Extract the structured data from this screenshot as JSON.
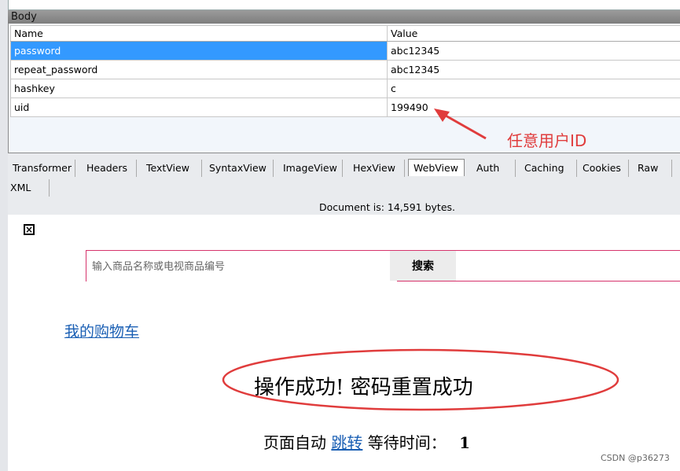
{
  "body_section": {
    "title": "Body",
    "columns": {
      "name": "Name",
      "value": "Value"
    },
    "rows": [
      {
        "name": "password",
        "value": "abc12345"
      },
      {
        "name": "repeat_password",
        "value": "abc12345"
      },
      {
        "name": "hashkey",
        "value": "c"
      },
      {
        "name": "uid",
        "value": "199490"
      }
    ]
  },
  "annotation": {
    "text": "任意用户ID",
    "color": "#e03c3c"
  },
  "tabs": [
    "Transformer",
    "Headers",
    "TextView",
    "SyntaxView",
    "ImageView",
    "HexView",
    "WebView",
    "Auth",
    "Caching",
    "Cookies",
    "Raw",
    "XML"
  ],
  "active_tab": "WebView",
  "doc_size": "Document is: 14,591 bytes.",
  "webview": {
    "close_icon": "close-x-icon",
    "search_placeholder": "输入商品名称或电视商品编号",
    "search_button": "搜索",
    "cart_link": "我的购物车",
    "result_message": "操作成功! 密码重置成功",
    "redirect_prefix": "页面自动",
    "redirect_link": "跳转",
    "redirect_wait": "等待时间：",
    "redirect_seconds": "1"
  },
  "watermark": "CSDN @p36273"
}
